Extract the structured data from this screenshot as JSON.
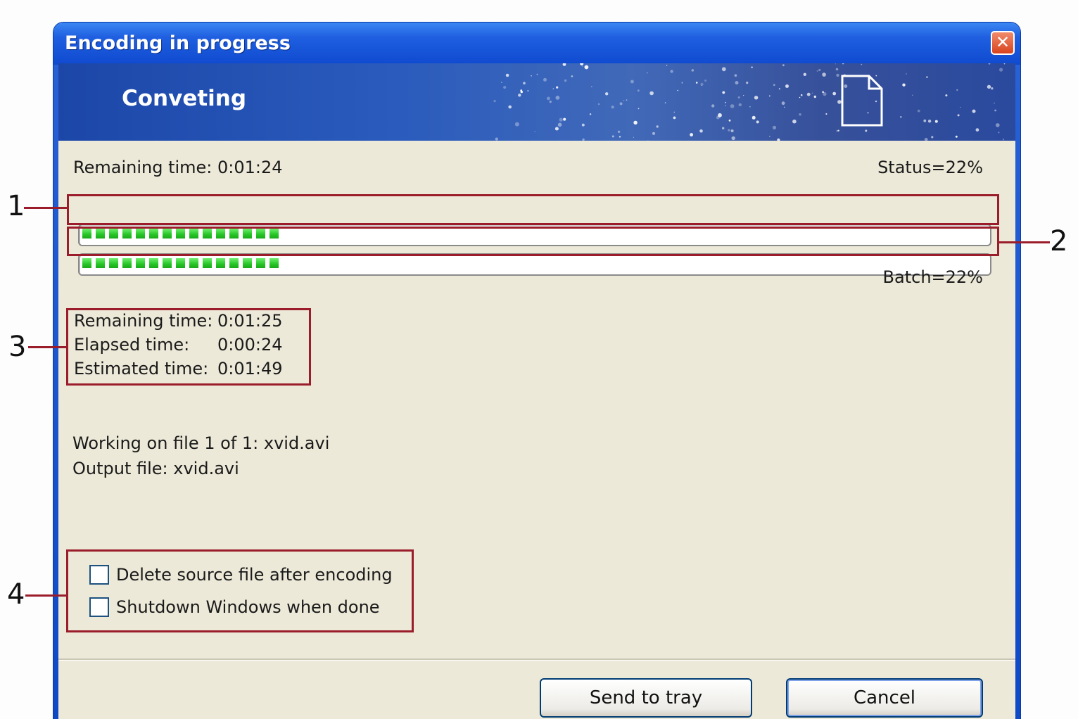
{
  "window": {
    "title": "Encoding in progress",
    "close_glyph": "✕"
  },
  "banner": {
    "title": "Conveting",
    "icon": "document-icon"
  },
  "status": {
    "remaining_label": "Remaining time: 0:01:24",
    "status_label": "Status=22%",
    "batch_label": "Batch=22%",
    "file_progress": 0.22,
    "batch_progress": 0.22
  },
  "times": {
    "remaining_label": "Remaining time:",
    "remaining_value": "0:01:25",
    "elapsed_label": "Elapsed time:",
    "elapsed_value": "0:00:24",
    "estimated_label": "Estimated time:",
    "estimated_value": "0:01:49"
  },
  "file_info": {
    "working_on": "Working on file 1 of 1: xvid.avi",
    "output": "Output file: xvid.avi"
  },
  "options": {
    "delete_source": {
      "label": "Delete source file after encoding",
      "checked": false
    },
    "shutdown": {
      "label": "Shutdown Windows when done",
      "checked": false
    }
  },
  "buttons": {
    "send_to_tray": "Send to tray",
    "cancel": "Cancel"
  },
  "callouts": [
    "1",
    "2",
    "3",
    "4"
  ],
  "colors": {
    "highlight": "#9b1d2b",
    "progress_green": "#26c526",
    "title_blue": "#0f4ad0",
    "dialog_bg": "#ece9d8"
  }
}
